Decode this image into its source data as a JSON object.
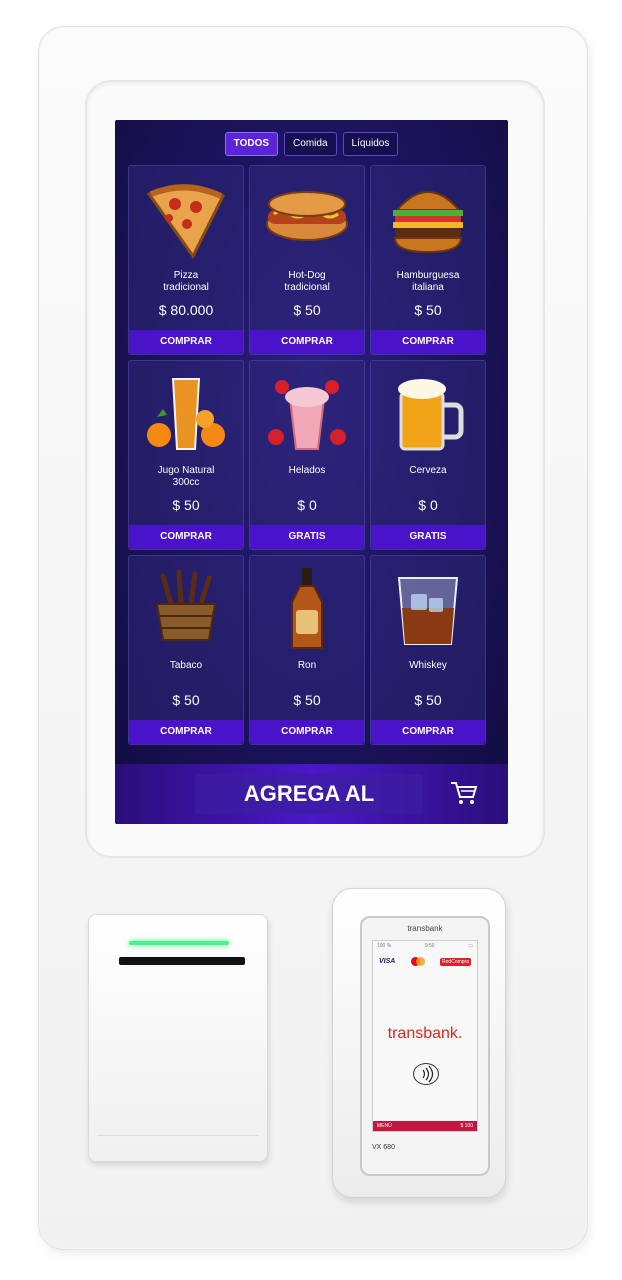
{
  "tabs": [
    {
      "label": "TODOS",
      "active": true
    },
    {
      "label": "Comida",
      "active": false
    },
    {
      "label": "Líquidos",
      "active": false
    }
  ],
  "products": [
    {
      "name": "Pizza\ntradicional",
      "price": "$ 80.000",
      "button": "COMPRAR",
      "icon": "pizza-slice-icon"
    },
    {
      "name": "Hot-Dog\ntradicional",
      "price": "$ 50",
      "button": "COMPRAR",
      "icon": "hot-dog-icon"
    },
    {
      "name": "Hamburguesa\nitaliana",
      "price": "$ 50",
      "button": "COMPRAR",
      "icon": "hamburger-icon"
    },
    {
      "name": "Jugo Natural\n300cc",
      "price": "$ 50",
      "button": "COMPRAR",
      "icon": "orange-juice-icon"
    },
    {
      "name": "Helados",
      "price": "$ 0",
      "button": "GRATIS",
      "icon": "strawberry-milkshake-icon"
    },
    {
      "name": "Cerveza",
      "price": "$ 0",
      "button": "GRATIS",
      "icon": "beer-mug-icon"
    },
    {
      "name": "Tabaco",
      "price": "$ 50",
      "button": "COMPRAR",
      "icon": "cigar-basket-icon"
    },
    {
      "name": "Ron",
      "price": "$ 50",
      "button": "COMPRAR",
      "icon": "rum-bottle-icon"
    },
    {
      "name": "Whiskey",
      "price": "$ 50",
      "button": "COMPRAR",
      "icon": "whiskey-glass-icon"
    }
  ],
  "cart": {
    "label": "AGREGA AL CARRITO",
    "icon": "shopping-cart-icon"
  },
  "terminal": {
    "brand_top": "transbank",
    "status_left": "100 %",
    "status_mid": "9:50",
    "card_brands": [
      "VISA",
      "Mastercard",
      "Redcompra"
    ],
    "visa": "VISA",
    "redcompra": "RedCompra",
    "logo": "transbank.",
    "menu_left": "MENÚ",
    "menu_right": "$ 100",
    "model": "VX 680"
  },
  "colors": {
    "screen_bg": "#1d1460",
    "button": "#4a12c9",
    "tab_active": "#5b24d6",
    "led": "#4cf08c",
    "transbank_red": "#d52b1e"
  }
}
